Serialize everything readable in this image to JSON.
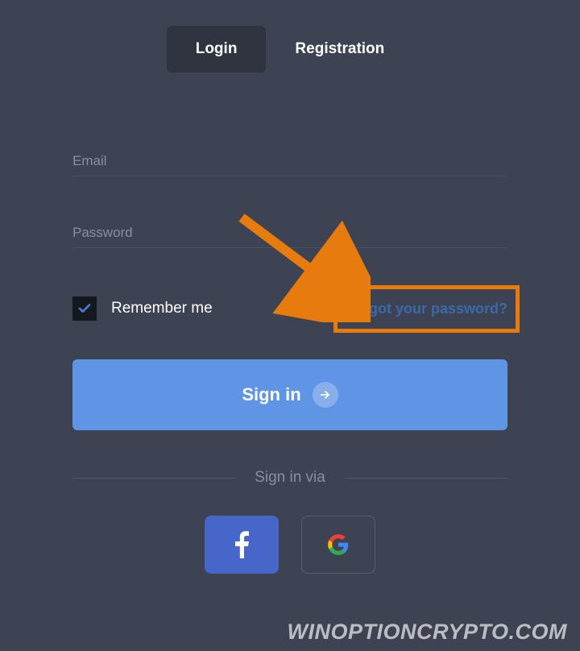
{
  "tabs": {
    "login": "Login",
    "registration": "Registration"
  },
  "fields": {
    "email_label": "Email",
    "password_label": "Password"
  },
  "remember": {
    "label": "Remember me",
    "checked": true
  },
  "forgot_link": "Forgot your password?",
  "signin_button": "Sign in",
  "divider": "Sign in via",
  "watermark": "WINOPTIONCRYPTO.COM",
  "colors": {
    "background": "#3d4352",
    "accent": "#6095e6",
    "highlight": "#e87b0e"
  }
}
